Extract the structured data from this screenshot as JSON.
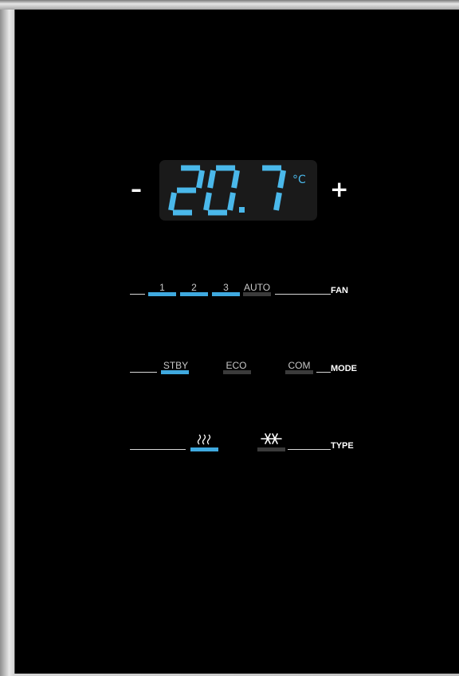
{
  "colors": {
    "background": "#000000",
    "accent_blue": "#3fa9df",
    "segment_blue": "#4ab8ea",
    "inactive_gray": "#3b3b3b",
    "display_bg": "#1a1a1a"
  },
  "temperature": {
    "minus_label": "–",
    "plus_label": "+",
    "value": "20.7",
    "unit": "°C"
  },
  "fan": {
    "label": "FAN",
    "options": [
      {
        "label": "1",
        "active": true
      },
      {
        "label": "2",
        "active": true
      },
      {
        "label": "3",
        "active": true
      },
      {
        "label": "AUTO",
        "active": false
      }
    ]
  },
  "mode": {
    "label": "MODE",
    "options": [
      {
        "label": "STBY",
        "active": true
      },
      {
        "label": "ECO",
        "active": false
      },
      {
        "label": "COM",
        "active": false
      }
    ]
  },
  "type": {
    "label": "TYPE",
    "options": [
      {
        "icon": "heat-waves-icon",
        "active": true
      },
      {
        "icon": "snowflake-icon",
        "active": false
      }
    ]
  }
}
